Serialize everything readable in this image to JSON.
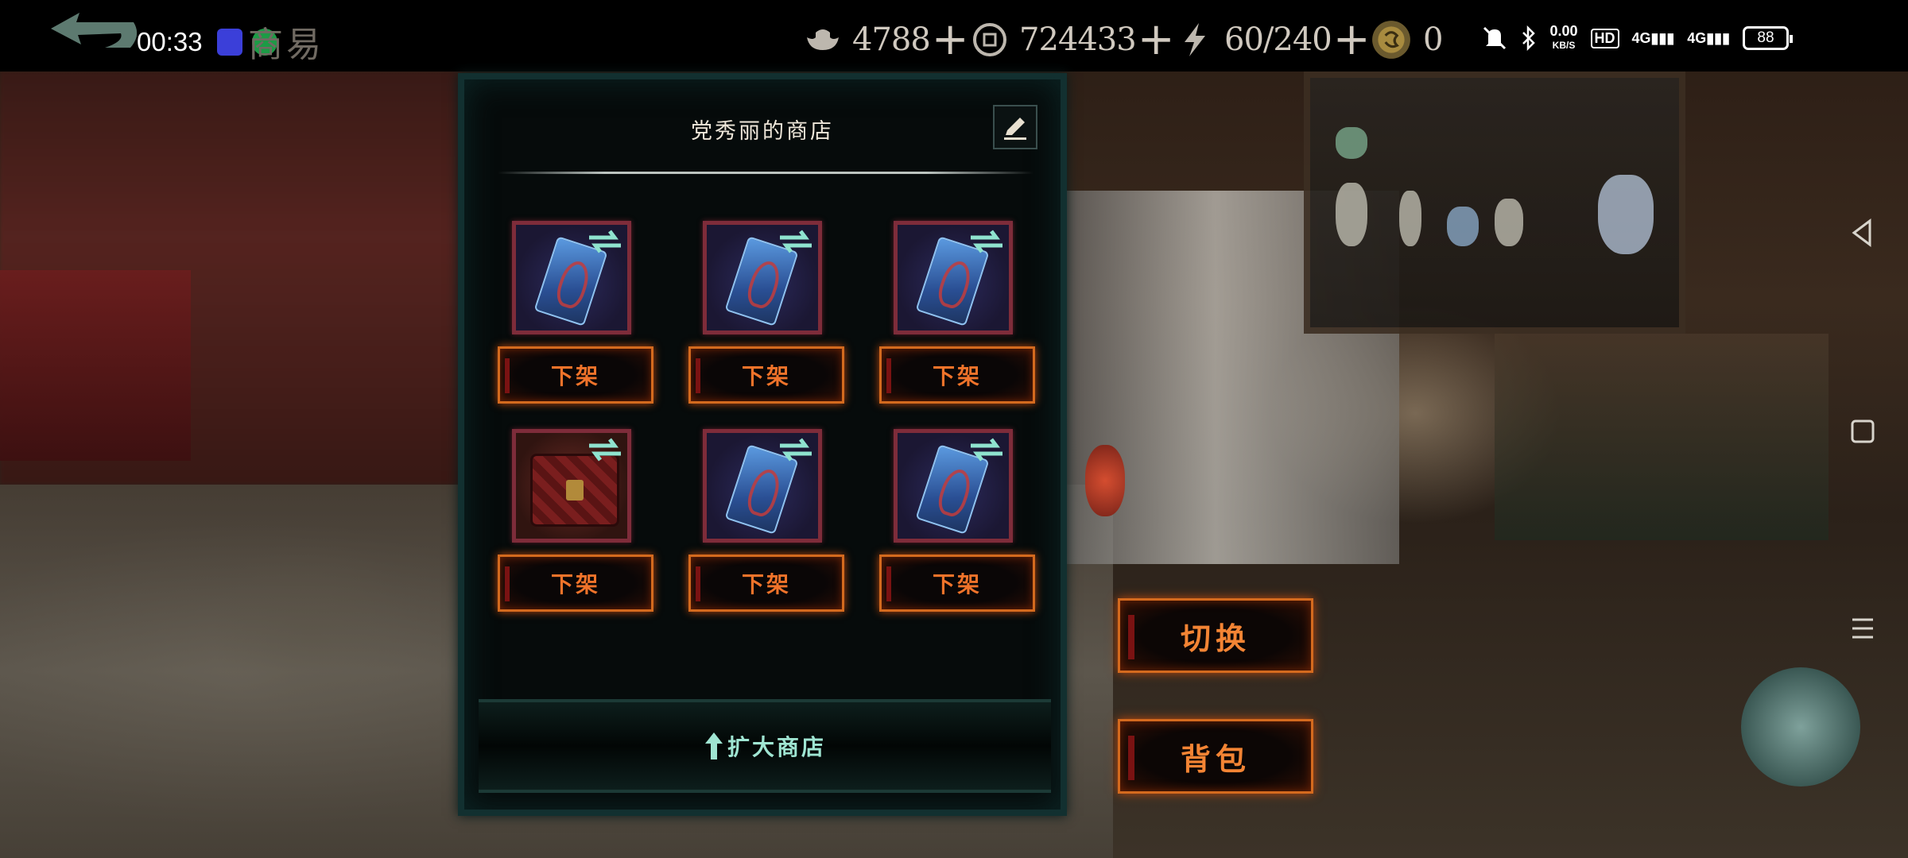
{
  "status_bar": {
    "time": "00:33",
    "screen_title": "商易",
    "resources": [
      {
        "icon": "silver-ingot-icon",
        "value": "4788"
      },
      {
        "icon": "coin-icon",
        "value": "724433"
      },
      {
        "icon": "lightning-icon",
        "value": "60/240"
      },
      {
        "icon": "gold-medallion-icon",
        "value": "0"
      }
    ],
    "net_speed": "0.00",
    "net_unit": "KB/S",
    "hd_tag": "HD",
    "signal_1": "4G",
    "signal_2": "4G",
    "battery": "88"
  },
  "shop": {
    "title": "党秀丽的商店",
    "items": [
      {
        "kind": "card",
        "action": "下架"
      },
      {
        "kind": "card",
        "action": "下架"
      },
      {
        "kind": "card",
        "action": "下架"
      },
      {
        "kind": "chest",
        "action": "下架"
      },
      {
        "kind": "card",
        "action": "下架"
      },
      {
        "kind": "card",
        "action": "下架"
      }
    ],
    "expand_label": "扩大商店"
  },
  "side_buttons": {
    "switch_label": "切换",
    "bag_label": "背包"
  },
  "colors": {
    "accent_orange": "#f0732a",
    "teal_text": "#9fe5d2",
    "frame_teal": "#123030"
  }
}
